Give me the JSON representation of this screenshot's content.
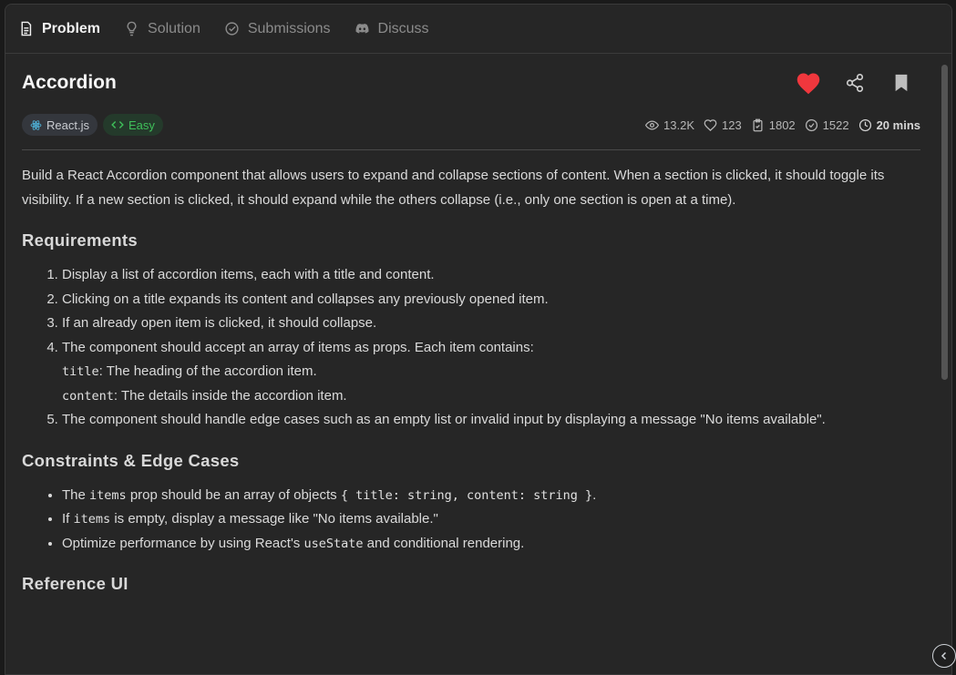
{
  "tabs": [
    {
      "label": "Problem",
      "icon": "document-icon"
    },
    {
      "label": "Solution",
      "icon": "lightbulb-icon"
    },
    {
      "label": "Submissions",
      "icon": "check-circle-icon"
    },
    {
      "label": "Discuss",
      "icon": "discord-icon"
    }
  ],
  "problem": {
    "title": "Accordion",
    "tags": {
      "tech": "React.js",
      "difficulty": "Easy"
    },
    "stats": {
      "views": "13.2K",
      "likes": "123",
      "submissions": "1802",
      "accepted": "1522",
      "time": "20 mins"
    },
    "description": "Build a React Accordion component that allows users to expand and collapse sections of content. When a section is clicked, it should toggle its visibility. If a new section is clicked, it should expand while the others collapse (i.e., only one section is open at a time).",
    "requirements_heading": "Requirements",
    "requirements": {
      "r1": "Display a list of accordion items, each with a title and content.",
      "r2": "Clicking on a title expands its content and collapses any previously opened item.",
      "r3": "If an already open item is clicked, it should collapse.",
      "r4": "The component should accept an array of items as props. Each item contains:",
      "r4a_code": "title",
      "r4a_text": ": The heading of the accordion item.",
      "r4b_code": "content",
      "r4b_text": ": The details inside the accordion item.",
      "r5": "The component should handle edge cases such as an empty list or invalid input by displaying a message \"No items available\"."
    },
    "constraints_heading": "Constraints & Edge Cases",
    "constraints": {
      "c1_pre": "The ",
      "c1_code": "items",
      "c1_mid": " prop should be an array of objects ",
      "c1_code2": "{ title: string, content: string }",
      "c1_post": ".",
      "c2_pre": "If ",
      "c2_code": "items",
      "c2_post": " is empty, display a message like \"No items available.\"",
      "c3_pre": "Optimize performance by using React's ",
      "c3_code": "useState",
      "c3_post": " and conditional rendering."
    },
    "reference_heading": "Reference UI"
  },
  "colors": {
    "heart": "#f0373d",
    "easy": "#3fbf5a",
    "react": "#4fb3d9"
  }
}
